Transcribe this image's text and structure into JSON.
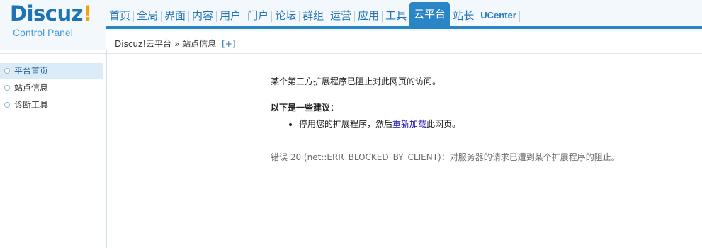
{
  "logo": {
    "brand_part1": "Discuz",
    "brand_part2": "!",
    "subtitle": "Control Panel"
  },
  "nav": {
    "items": [
      "首页",
      "全局",
      "界面",
      "内容",
      "用户",
      "门户",
      "论坛",
      "群组",
      "运营",
      "应用",
      "工具",
      "云平台",
      "站长",
      "UCenter"
    ],
    "active": "云平台"
  },
  "breadcrumb": {
    "text": "Discuz!云平台 » 站点信息",
    "add": "[+]"
  },
  "sidebar": {
    "items": [
      {
        "label": "平台首页",
        "active": true
      },
      {
        "label": "站点信息",
        "active": false
      },
      {
        "label": "诊断工具",
        "active": false
      }
    ]
  },
  "message": {
    "line1": "某个第三方扩展程序已阻止对此网页的访问。",
    "subhead": "以下是一些建议：",
    "suggestion_prefix": "停用您的扩展程序，然后",
    "reload_link": "重新加载",
    "suggestion_suffix": "此网页。",
    "error": "错误 20 (net::ERR_BLOCKED_BY_CLIENT)：对服务器的请求已遭到某个扩展程序的阻止。"
  }
}
